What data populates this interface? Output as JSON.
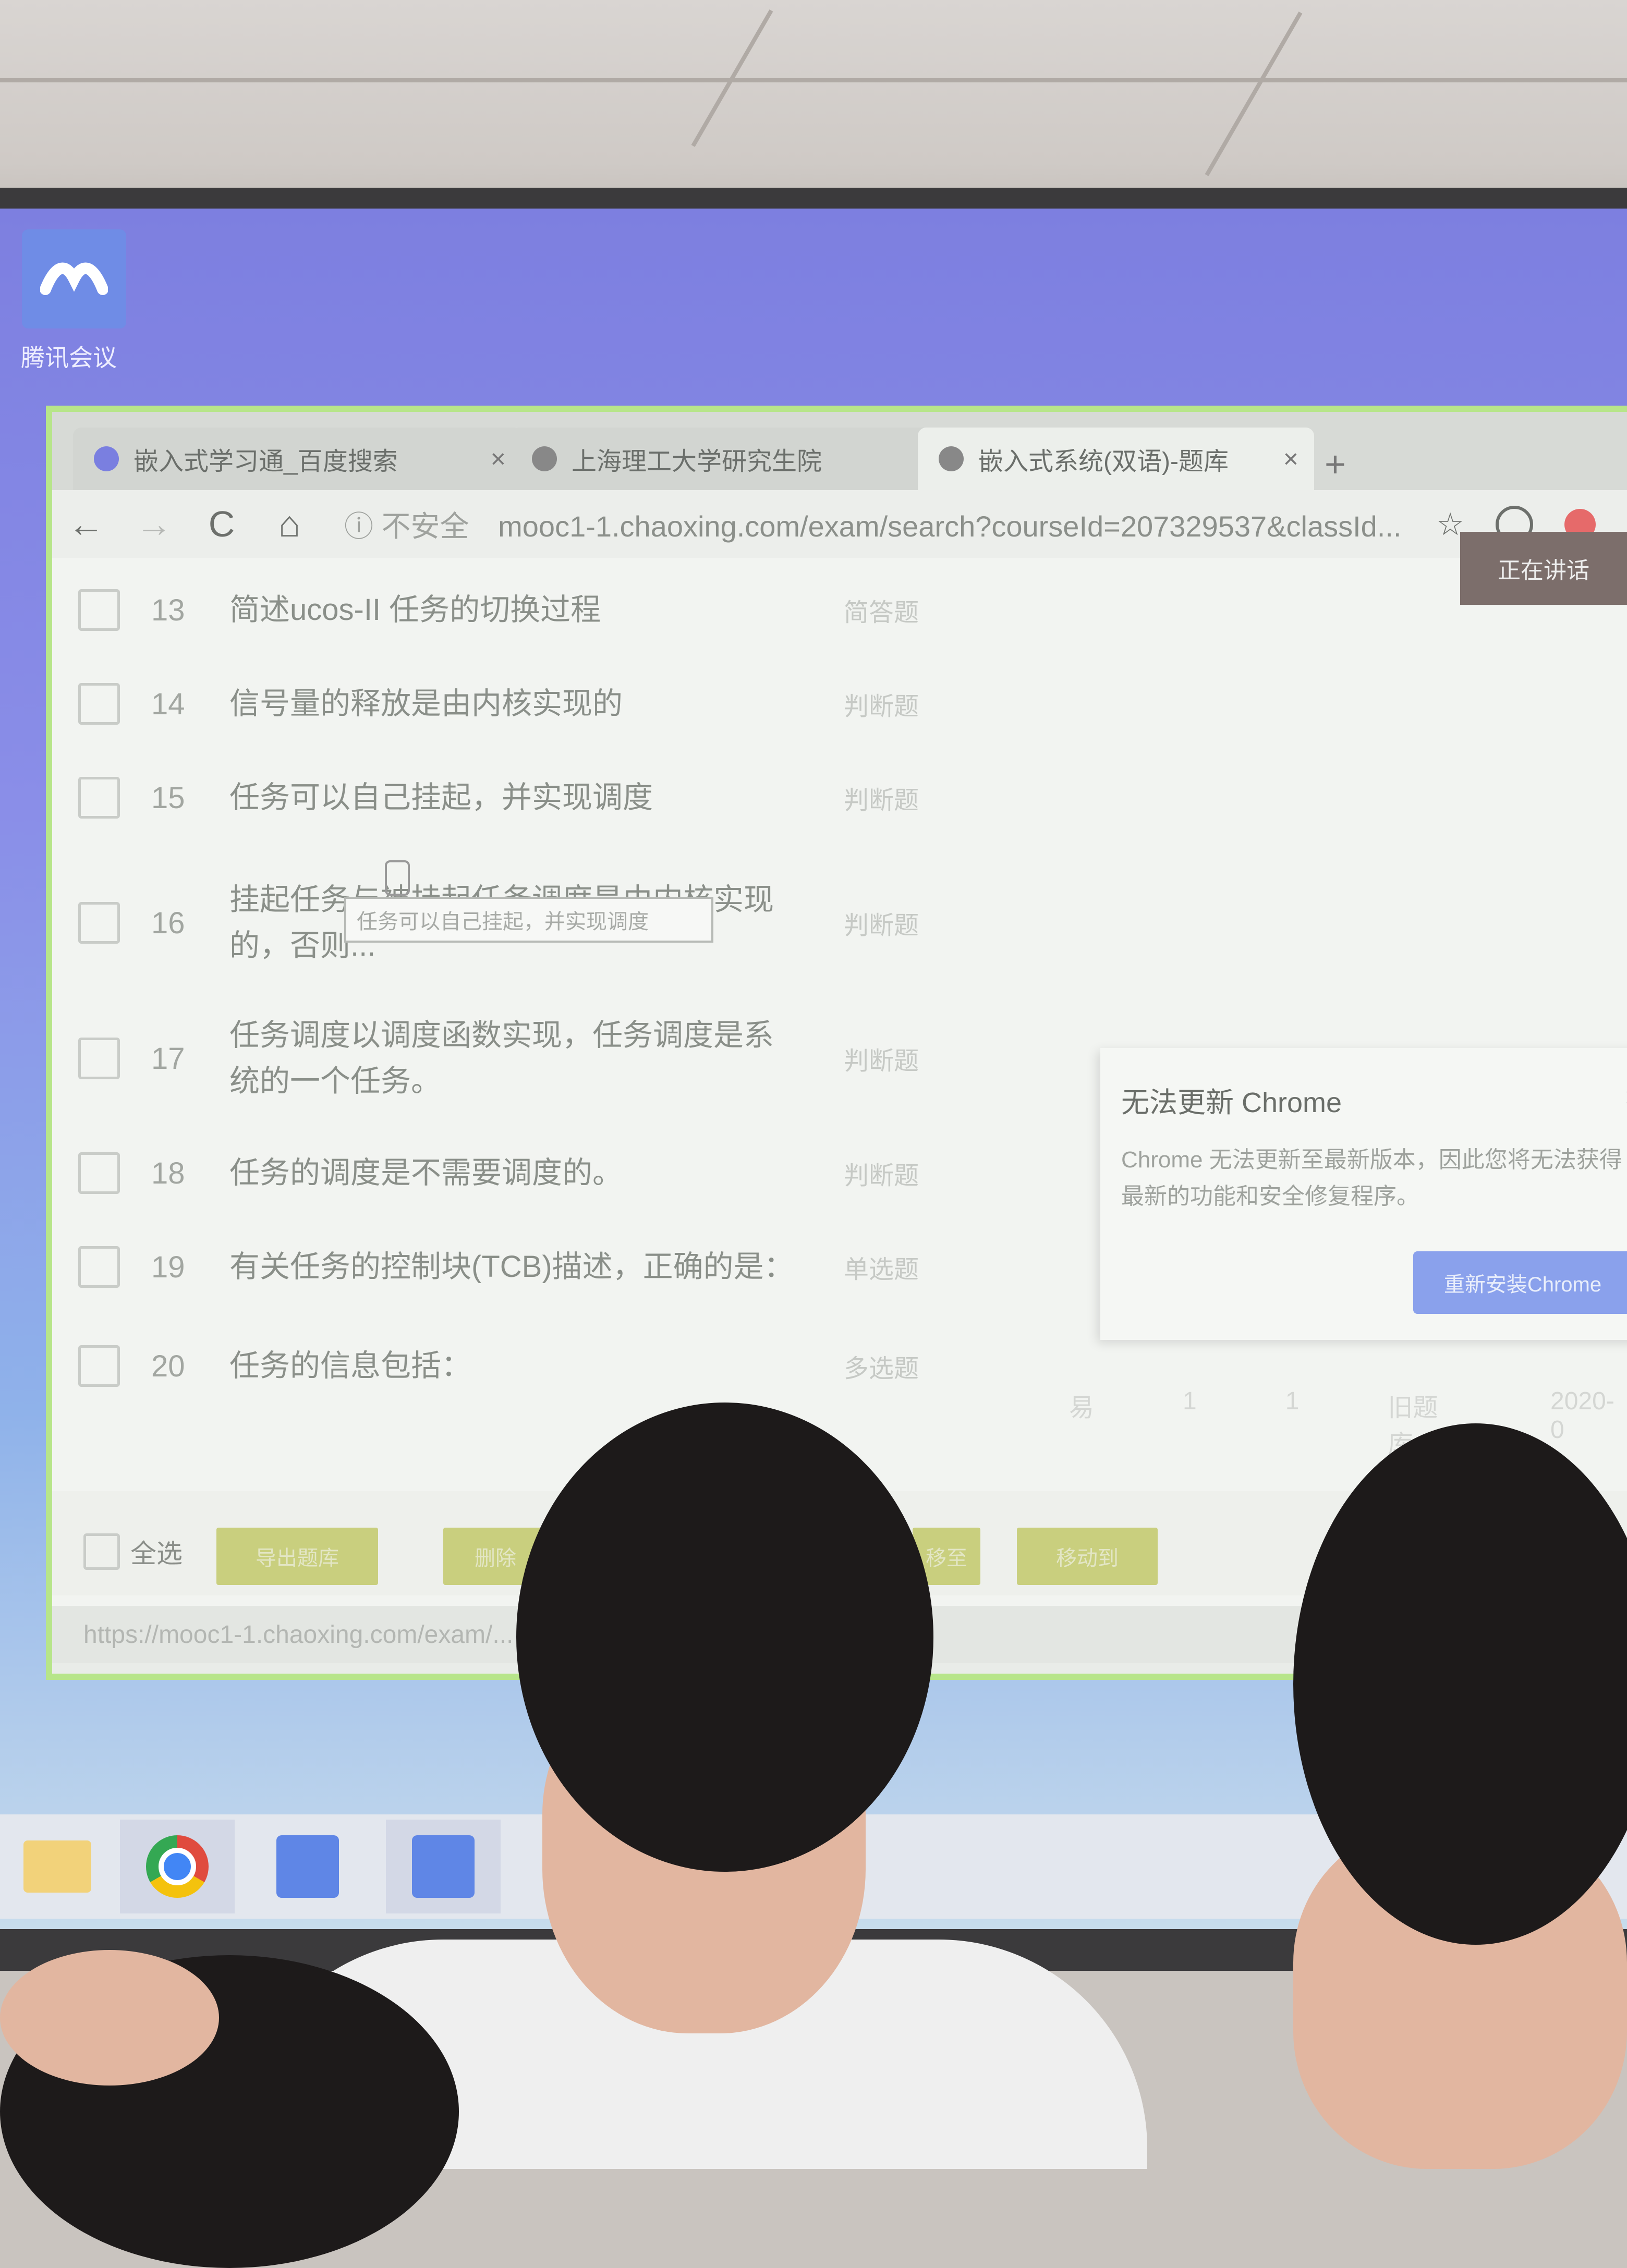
{
  "desktop": {
    "icon_label": "腾讯会议"
  },
  "browser": {
    "tabs": [
      {
        "title": "嵌入式学习通_百度搜索",
        "close": "×"
      },
      {
        "title": "上海理工大学研究生院",
        "close": "×"
      },
      {
        "title": "嵌入式系统(双语)-题库",
        "close": "×"
      }
    ],
    "new_tab": "+",
    "toolbar": {
      "back": "←",
      "forward": "→",
      "reload": "C",
      "home": "⌂",
      "insecure_label": "ⓘ 不安全",
      "url": "mooc1-1.chaoxing.com/exam/search?courseId=207329537&classId..."
    },
    "corner_badge": "正在讲话"
  },
  "questions": [
    {
      "num": "13",
      "text": "简述ucos-II 任务的切换过程",
      "type": "简答题"
    },
    {
      "num": "14",
      "text": "信号量的释放是由内核实现的",
      "type": "判断题"
    },
    {
      "num": "15",
      "text": "任务可以自己挂起，并实现调度",
      "type": "判断题"
    },
    {
      "num": "16",
      "text": "挂起任务与被挂起任务调度是由内核实现的，否则...",
      "type": "判断题"
    },
    {
      "num": "17",
      "text": "任务调度以调度函数实现，任务调度是系统的一个任务。",
      "type": "判断题"
    },
    {
      "num": "18",
      "text": "任务的调度是不需要调度的。",
      "type": "判断题"
    },
    {
      "num": "19",
      "text": "有关任务的控制块(TCB)描述，正确的是：",
      "type": "单选题"
    },
    {
      "num": "20",
      "text": "任务的信息包括：",
      "type": "多选题"
    }
  ],
  "question_extra": [
    "易",
    "1",
    "1",
    "旧题库",
    "2020-0"
  ],
  "tooltip": "任务可以自己挂起，并实现调度",
  "popup": {
    "title": "无法更新 Chrome",
    "body": "Chrome 无法更新至最新版本，因此您将无法获得最新的功能和安全修复程序。",
    "button": "重新安装Chrome",
    "close": "×"
  },
  "bottom": {
    "select_all": "全选",
    "export_label": "导出题库",
    "delete_label": "删除",
    "move_label": "移至",
    "batch_label": "移动到"
  },
  "status_url": "https://mooc1-1.chaoxing.com/exam/..."
}
